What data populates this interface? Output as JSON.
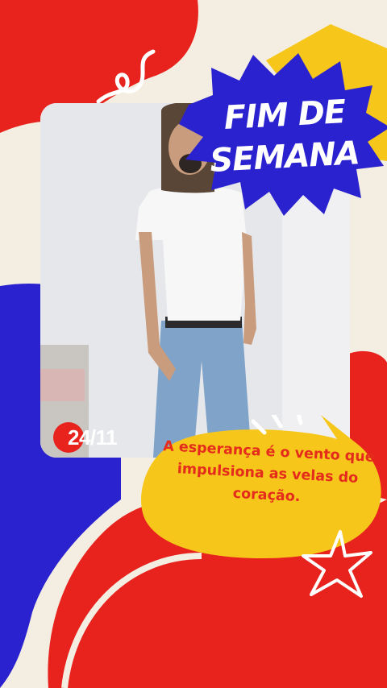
{
  "title": {
    "line1": "FIM DE",
    "line2": "SEMANA"
  },
  "date_badge": "24/11",
  "quote": "A esperança é o vento que impulsiona as velas do coração.",
  "colors": {
    "background": "#f4eee2",
    "red": "#e8231e",
    "blue": "#2b22cf",
    "yellow": "#f6c61a",
    "white": "#ffffff"
  },
  "icons": [
    "swirl-doodle-icon",
    "starburst-icon",
    "spark-lines-icon",
    "star-outline-icon"
  ]
}
